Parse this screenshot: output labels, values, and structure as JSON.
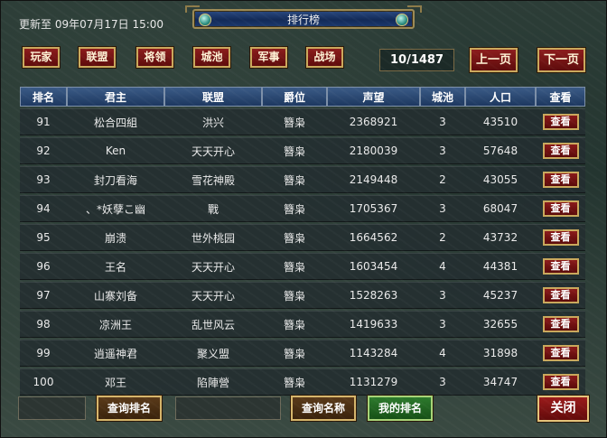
{
  "header": {
    "updated": "更新至 09年07月17日 15:00",
    "title": "排行榜"
  },
  "tabs": [
    {
      "label": "玩家",
      "selected": true
    },
    {
      "label": "联盟",
      "selected": false
    },
    {
      "label": "将领",
      "selected": false
    },
    {
      "label": "城池",
      "selected": false
    },
    {
      "label": "军事",
      "selected": true
    },
    {
      "label": "战场",
      "selected": false
    }
  ],
  "pagination": {
    "page_indicator": "10/1487",
    "prev_label": "上一页",
    "next_label": "下一页"
  },
  "table": {
    "columns": [
      "排名",
      "君主",
      "联盟",
      "爵位",
      "声望",
      "城池",
      "人口",
      "查看"
    ],
    "view_label": "查看",
    "rows": [
      [
        "91",
        "松合四組",
        "洪兴",
        "簪枭",
        "2368921",
        "3",
        "43510"
      ],
      [
        "92",
        "Ken",
        "天天开心",
        "簪枭",
        "2180039",
        "3",
        "57648"
      ],
      [
        "93",
        "封刀看海",
        "雪花神殿",
        "簪枭",
        "2149448",
        "2",
        "43055"
      ],
      [
        "94",
        "、*妖孽こ幽",
        "戰",
        "簪枭",
        "1705367",
        "3",
        "68047"
      ],
      [
        "95",
        "崩溃",
        "世外桃园",
        "簪枭",
        "1664562",
        "2",
        "43732"
      ],
      [
        "96",
        "王名",
        "天天开心",
        "簪枭",
        "1603454",
        "4",
        "44381"
      ],
      [
        "97",
        "山寨刘备",
        "天天开心",
        "簪枭",
        "1528263",
        "3",
        "45237"
      ],
      [
        "98",
        "凉洲王",
        "乱世风云",
        "簪枭",
        "1419633",
        "3",
        "32655"
      ],
      [
        "99",
        "逍遥神君",
        "聚义盟",
        "簪枭",
        "1143284",
        "4",
        "31898"
      ],
      [
        "100",
        "邓王",
        "陷陣營",
        "簪枭",
        "1131279",
        "3",
        "34747"
      ]
    ]
  },
  "bottom": {
    "query_rank_label": "查询排名",
    "query_name_label": "查询名称",
    "my_rank_label": "我的排名",
    "close_label": "关闭"
  }
}
